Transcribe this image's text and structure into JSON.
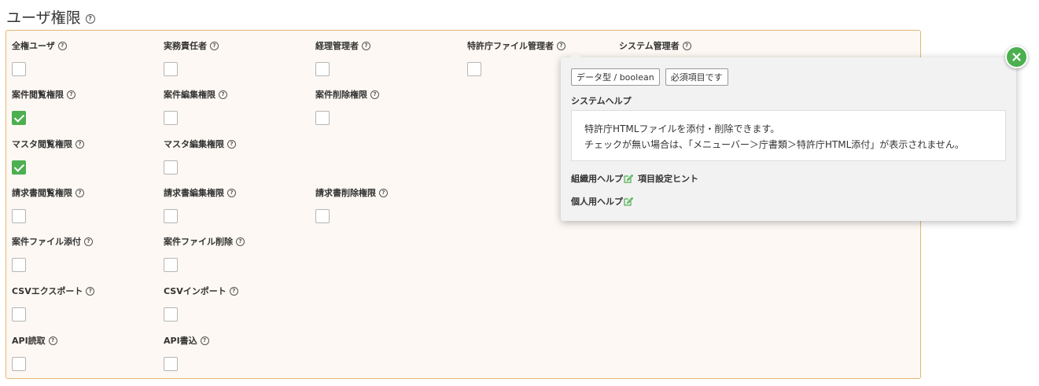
{
  "page": {
    "title": "ユーザ権限",
    "help_glyph": "?"
  },
  "fields": [
    {
      "label": "全権ユーザ",
      "checked": false
    },
    {
      "label": "実務責任者",
      "checked": false
    },
    {
      "label": "経理管理者",
      "checked": false
    },
    {
      "label": "特許庁ファイル管理者",
      "checked": false
    },
    {
      "label": "システム管理者",
      "checked": false
    },
    {
      "label": "案件閲覧権限",
      "checked": true
    },
    {
      "label": "案件編集権限",
      "checked": false
    },
    {
      "label": "案件削除権限",
      "checked": false
    },
    {
      "label": "マスタ閲覧権限",
      "checked": true
    },
    {
      "label": "マスタ編集権限",
      "checked": false
    },
    {
      "label": "請求書閲覧権限",
      "checked": false
    },
    {
      "label": "請求書編集権限",
      "checked": false
    },
    {
      "label": "請求書削除権限",
      "checked": false
    },
    {
      "label": "案件ファイル添付",
      "checked": false
    },
    {
      "label": "案件ファイル削除",
      "checked": false
    },
    {
      "label": "CSVエクスポート",
      "checked": false
    },
    {
      "label": "CSVインポート",
      "checked": false
    },
    {
      "label": "API読取",
      "checked": false
    },
    {
      "label": "API書込",
      "checked": false
    }
  ],
  "popover": {
    "badge_type": "データ型 / boolean",
    "badge_required": "必須項目です",
    "system_help_title": "システムヘルプ",
    "help_line_1": "特許庁HTMLファイルを添付・削除できます。",
    "help_line_2": "チェックが無い場合は、「メニューバー＞庁書類＞特許庁HTML添付」が表示されません。",
    "org_help_label": "組織用ヘルプ",
    "org_help_hint": "項目設定ヒント",
    "personal_help_label": "個人用ヘルプ",
    "close_glyph": "×"
  },
  "colors": {
    "accent_green": "#4caf50",
    "panel_border": "#e6b673",
    "panel_bg": "#fdf8f3"
  }
}
